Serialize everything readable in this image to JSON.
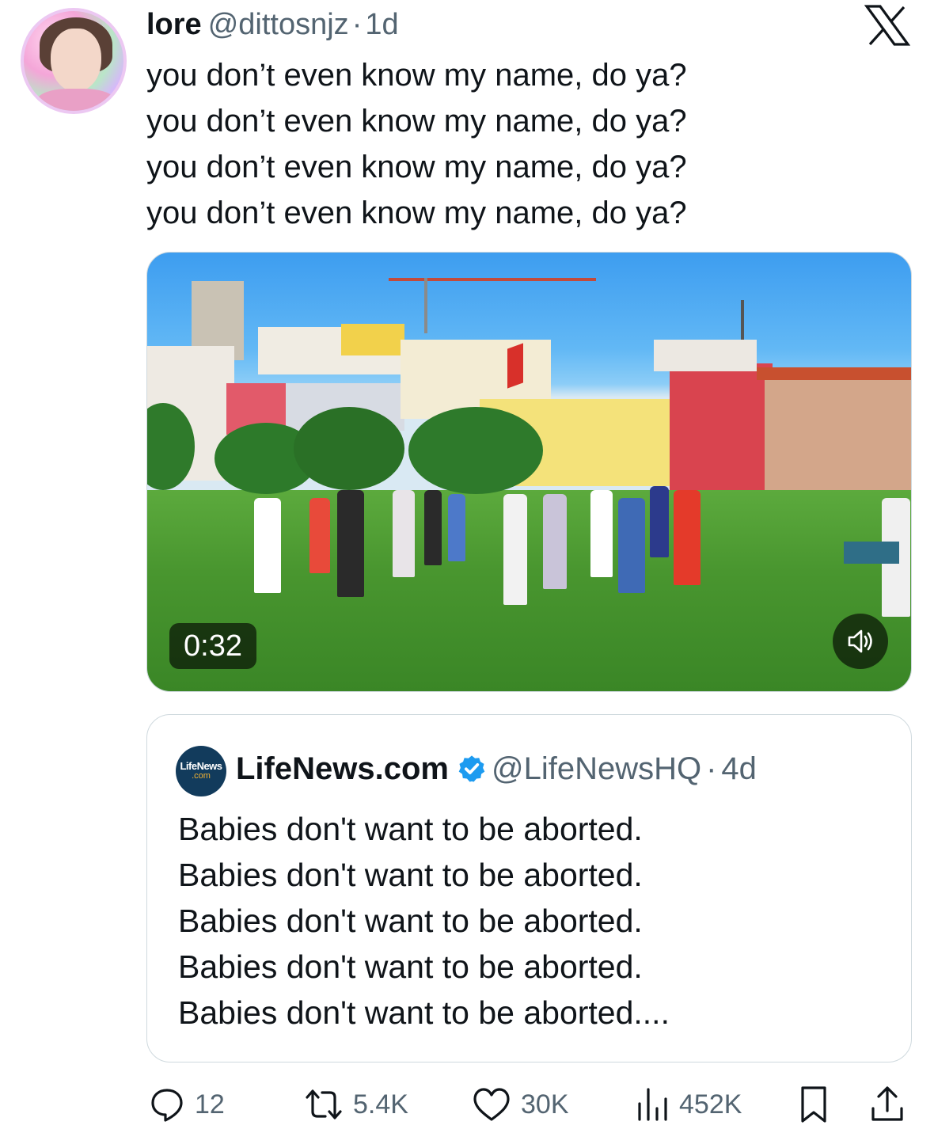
{
  "author": {
    "name": "lore",
    "handle": "@dittosnjz",
    "separator": "·",
    "time": "1d",
    "avatar_icon": "user-avatar"
  },
  "tweet_lines": [
    "you don’t even know my name, do ya?",
    "you don’t even know my name, do ya?",
    "you don’t even know my name, do ya?",
    "you don’t even know my name, do ya?"
  ],
  "media": {
    "duration": "0:32",
    "volume_icon": "volume-icon"
  },
  "quote": {
    "avatar_line1": "LifeNews",
    "avatar_line2": ".com",
    "name": "LifeNews.com",
    "verified_icon": "verified-badge-icon",
    "handle": "@LifeNewsHQ",
    "separator": "·",
    "time": "4d",
    "lines": [
      "Babies don't want to be aborted.",
      "Babies don't want to be aborted.",
      "Babies don't want to be aborted.",
      "Babies don't want to be aborted.",
      "Babies don't want to be aborted...."
    ]
  },
  "actions": {
    "replies": "12",
    "reposts": "5.4K",
    "likes": "30K",
    "views": "452K"
  },
  "colors": {
    "text": "#0f1419",
    "secondary": "#536471",
    "verified": "#1d9bf0",
    "border": "#cfd9de"
  }
}
